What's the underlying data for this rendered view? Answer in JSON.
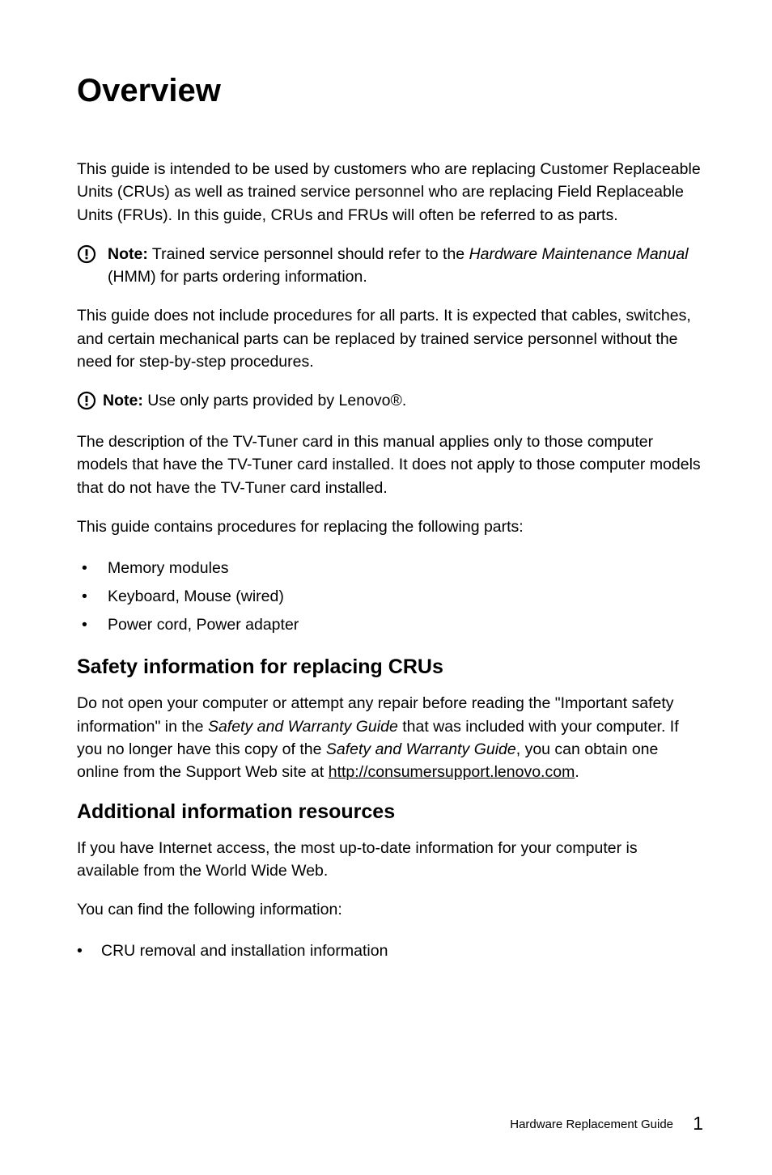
{
  "title": "Overview",
  "intro": "This guide is intended to be used by customers who are replacing Customer Replaceable Units (CRUs) as well as trained service personnel who are replacing Field Replaceable Units (FRUs). In this guide, CRUs and FRUs will often be referred to as parts.",
  "note1_label": "Note:",
  "note1_pre": " Trained service personnel should refer to the ",
  "note1_em": "Hardware Maintenance Manual",
  "note1_post": " (HMM) for parts ordering information.",
  "p2": "This guide does not include procedures for all parts. It is expected that cables, switches, and certain mechanical parts can be replaced by trained service personnel without the need for step-by-step procedures.",
  "note2_label": "Note:",
  "note2_text": " Use only parts provided by Lenovo®.",
  "p3": "The description of the TV-Tuner card in this manual applies only to those computer models that have the TV-Tuner card installed. It does not apply to those computer models that do not have the TV-Tuner card installed.",
  "p4": "This guide contains procedures for replacing the following parts:",
  "parts": [
    "Memory modules",
    "Keyboard, Mouse (wired)",
    "Power cord, Power adapter"
  ],
  "h2_safety": "Safety information for replacing CRUs",
  "safety_pre": "Do not open your computer or attempt any repair before reading the \"Important safety information\" in the ",
  "safety_em1": "Safety and Warranty Guide",
  "safety_mid": " that was included with your computer. If you no longer have this copy of the ",
  "safety_em2": "Safety and Warranty Guide",
  "safety_post": ", you can obtain one online from the Support Web site at ",
  "safety_link": "http://consumersupport.lenovo.com",
  "safety_end": ".",
  "h2_additional": "Additional information resources",
  "add_p1": "If you have Internet access, the most up-to-date information for your computer is available from the World Wide Web.",
  "add_p2": "You can find the following information:",
  "add_items": [
    "CRU removal and installation information"
  ],
  "footer_text": "Hardware Replacement Guide",
  "page_number": "1"
}
